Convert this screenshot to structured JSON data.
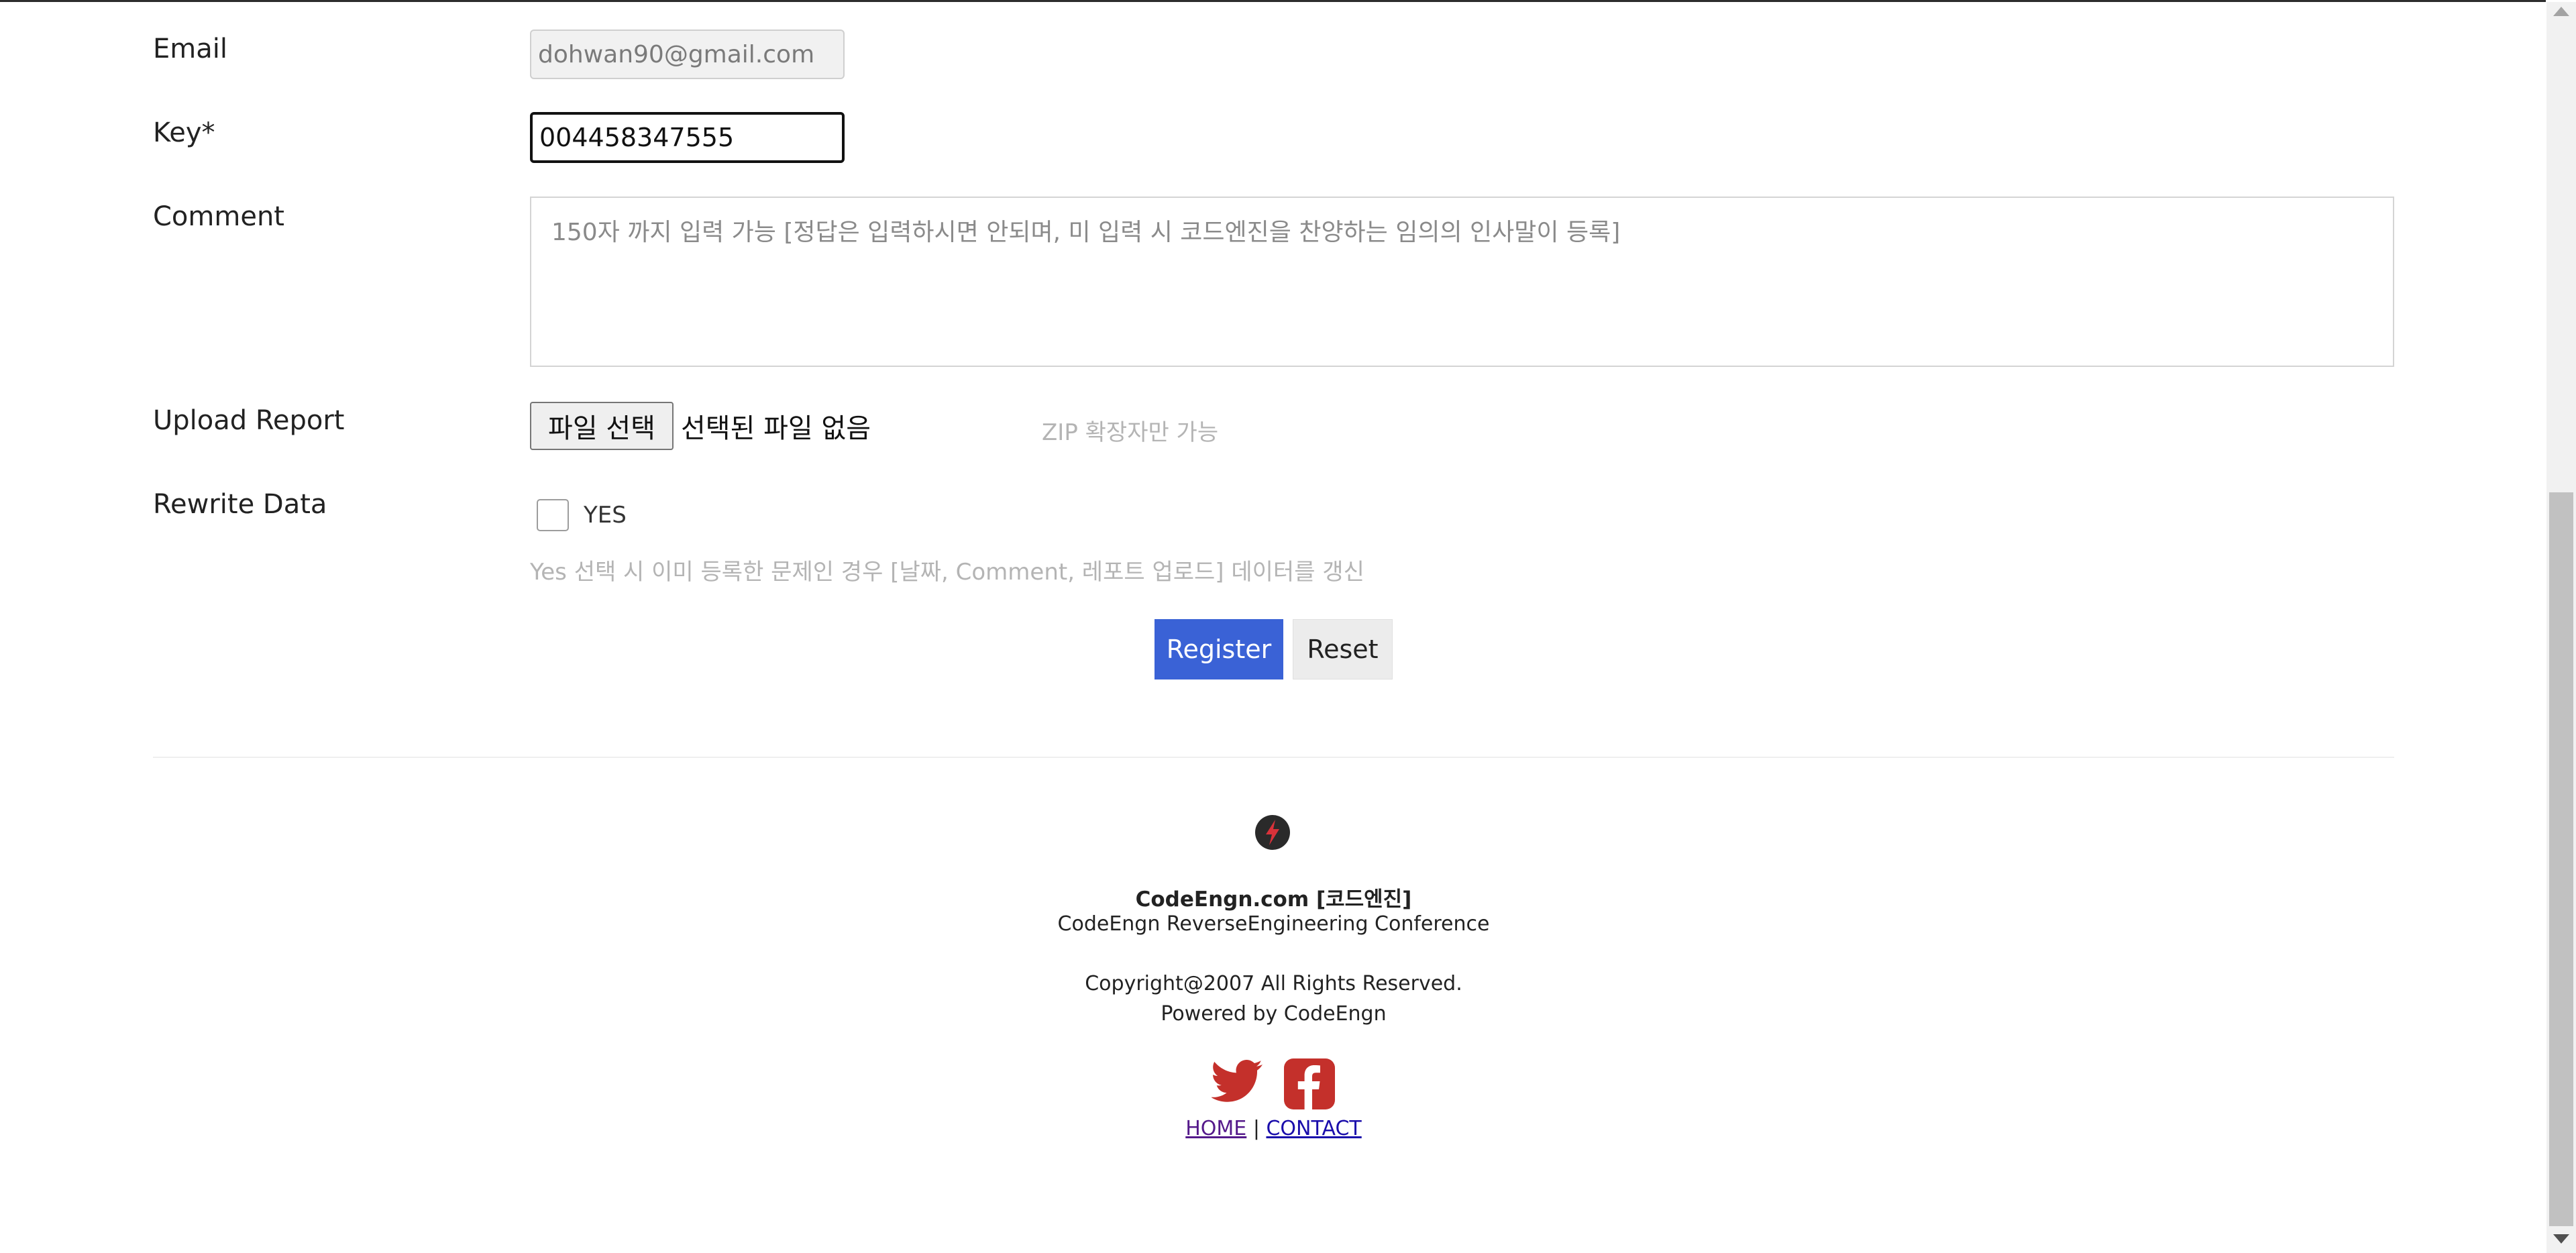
{
  "form": {
    "email_label": "Email",
    "email_value": "dohwan90@gmail.com",
    "key_label": "Key*",
    "key_value": "004458347555",
    "comment_label": "Comment",
    "comment_placeholder": "150자 까지 입력 가능 [정답은 입력하시면 안되며, 미 입력 시 코드엔진을 찬양하는 임의의 인사말이 등록]",
    "upload_label": "Upload Report",
    "file_button": "파일 선택",
    "file_status": "선택된 파일 없음",
    "file_hint": "ZIP 확장자만 가능",
    "rewrite_label": "Rewrite Data",
    "rewrite_checkbox_label": "YES",
    "rewrite_checked": false,
    "rewrite_hint": "Yes 선택 시 이미 등록한 문제인 경우 [날짜, Comment, 레포트 업로드] 데이터를 갱신",
    "register_button": "Register",
    "reset_button": "Reset"
  },
  "footer": {
    "logo_icon": "lightning-bolt-icon",
    "brand": "CodeEngn.com [코드엔진]",
    "conference": "CodeEngn ReverseEngineering Conference",
    "copyright": "Copyright@2007 All Rights Reserved.",
    "powered": "Powered by CodeEngn",
    "social": [
      "twitter-icon",
      "facebook-icon"
    ],
    "home_link": "HOME",
    "separator": "|",
    "contact_link": "CONTACT",
    "social_color": "#c4302b"
  },
  "colors": {
    "primary": "#3a62d6",
    "hint_text": "#b4b4b4"
  }
}
